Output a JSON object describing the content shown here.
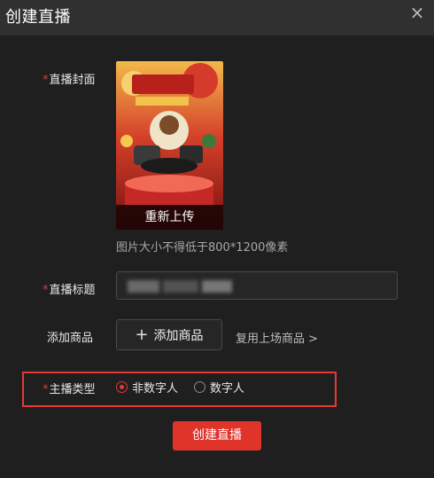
{
  "window": {
    "title": "创建直播",
    "close_glyph": "×"
  },
  "form": {
    "cover": {
      "required_mark": "*",
      "label": "直播封面",
      "reupload_label": "重新上传",
      "hint": "图片大小不得低于800*1200像素"
    },
    "live_title": {
      "required_mark": "*",
      "label": "直播标题",
      "value": ""
    },
    "products": {
      "label": "添加商品",
      "add_button_icon": "plus-icon",
      "add_button_label": "添加商品",
      "reuse_link_label": "复用上场商品 >"
    },
    "host_type": {
      "required_mark": "*",
      "label": "主播类型",
      "options": [
        {
          "label": "非数字人",
          "selected": true
        },
        {
          "label": "数字人",
          "selected": false
        }
      ]
    },
    "submit_label": "创建直播"
  },
  "colors": {
    "accent": "#e0332a",
    "background": "#1f1f1f",
    "titlebar": "#303030"
  }
}
